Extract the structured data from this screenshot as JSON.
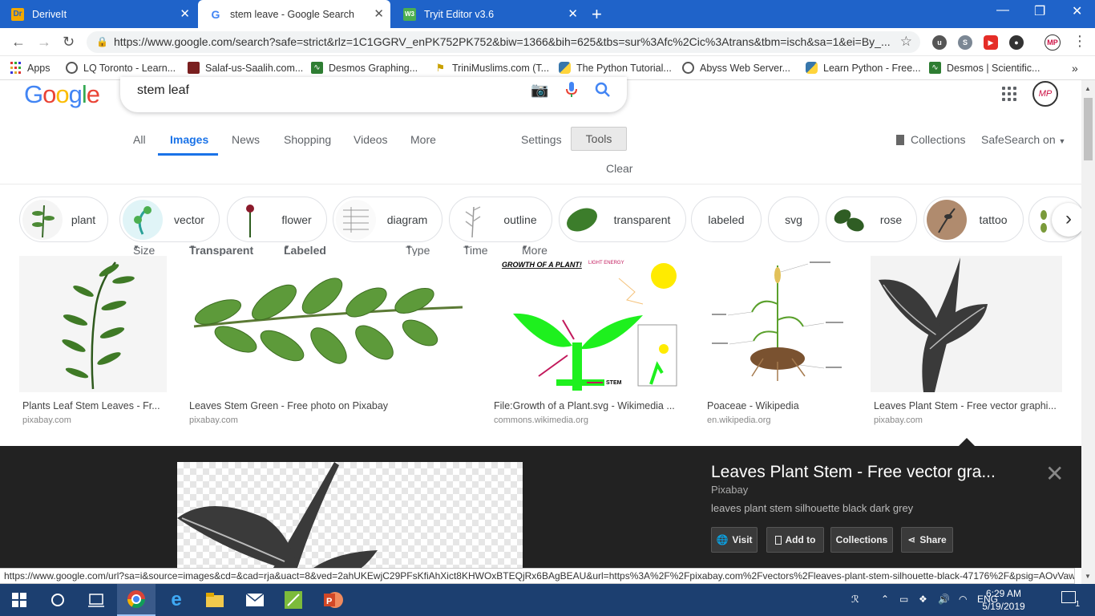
{
  "browser": {
    "tabs": [
      {
        "title": "DeriveIt",
        "icon": "derivit-favicon"
      },
      {
        "title": "stem leave - Google Search",
        "icon": "google-favicon"
      },
      {
        "title": "Tryit Editor v3.6",
        "icon": "w3-favicon"
      }
    ],
    "url": "https://www.google.com/search?safe=strict&rlz=1C1GGRV_enPK752PK752&biw=1366&bih=625&tbs=sur%3Afc%2Cic%3Atrans&tbm=isch&sa=1&ei=By_...",
    "bookmarks": [
      "Apps",
      "LQ Toronto - Learn...",
      "Salaf-us-Saalih.com...",
      "Desmos Graphing...",
      "TriniMuslims.com (T...",
      "The Python Tutorial...",
      "Abyss Web Server...",
      "Learn Python - Free...",
      "Desmos | Scientific..."
    ]
  },
  "google": {
    "logo": "Google",
    "query": "stem leaf",
    "tabs": [
      "All",
      "Images",
      "News",
      "Shopping",
      "Videos",
      "More"
    ],
    "settings": "Settings",
    "tools": "Tools",
    "collections": "Collections",
    "safesearch": "SafeSearch on",
    "filters": [
      "Size",
      "Transparent",
      "Labeled for reuse",
      "Type",
      "Time",
      "More tools",
      "Clear"
    ],
    "chips": [
      "plant",
      "vector",
      "flower",
      "diagram",
      "outline",
      "transparent",
      "labeled",
      "svg",
      "rose",
      "tattoo"
    ]
  },
  "results": [
    {
      "title": "Plants Leaf Stem Leaves - Fr...",
      "source": "pixabay.com"
    },
    {
      "title": "Leaves Stem Green - Free photo on Pixabay",
      "source": "pixabay.com"
    },
    {
      "title": "File:Growth of a Plant.svg - Wikimedia ...",
      "source": "commons.wikimedia.org"
    },
    {
      "title": "Poaceae - Wikipedia",
      "source": "en.wikipedia.org"
    },
    {
      "title": "Leaves Plant Stem - Free vector graphi...",
      "source": "pixabay.com"
    }
  ],
  "diagram_labels": {
    "title": "GROWTH OF A PLANT!",
    "light": "LIGHT ENERGY",
    "stem": "STEM"
  },
  "preview": {
    "title": "Leaves Plant Stem - Free vector gra...",
    "site": "Pixabay",
    "description": "leaves plant stem silhouette black dark grey",
    "buttons": [
      "Visit",
      "Add to",
      "Collections",
      "Share"
    ]
  },
  "status_url": "https://www.google.com/url?sa=i&source=images&cd=&cad=rja&uact=8&ved=2ahUKEwjC29PFsKfiAhXict8KHWOxBTEQjRx6BAgBEAU&url=https%3A%2F%2Fpixabay.com%2Fvectors%2Fleaves-plant-stem-silhouette-black-47176%2F&psig=AOvVaw3...",
  "taskbar": {
    "lang": "ENG",
    "time": "6:29 AM",
    "date": "5/19/2019",
    "notifications": "1"
  },
  "colors": {
    "tabstrip": "#1f63c9",
    "google_blue": "#1a73e8",
    "taskbar": "#1c3f70",
    "preview_bg": "#222222"
  }
}
